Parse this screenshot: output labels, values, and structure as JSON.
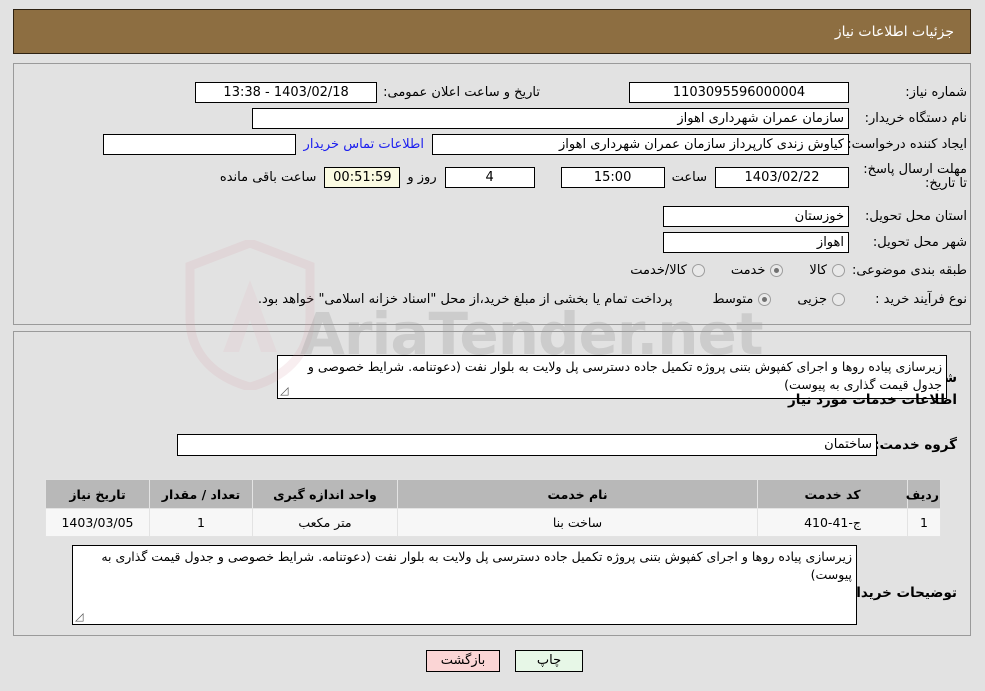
{
  "header": {
    "title": "جزئیات اطلاعات نیاز"
  },
  "top_form": {
    "need_number_label": "شماره نیاز:",
    "need_number_value": "1103095596000004",
    "public_announce_label": "تاریخ و ساعت اعلان عمومی:",
    "public_announce_value": "1403/02/18 - 13:38",
    "buyer_org_label": "نام دستگاه خریدار:",
    "buyer_org_value": "سازمان عمران شهرداری اهواز",
    "creator_label": "ایجاد کننده درخواست:",
    "creator_value": "کیاوش زندی کارپرداز سازمان عمران شهرداری اهواز",
    "contact_link": "اطلاعات تماس خریدار",
    "deadline_label": "مهلت ارسال پاسخ: تا تاریخ:",
    "deadline_date": "1403/02/22",
    "hour_label": "ساعت",
    "deadline_time": "15:00",
    "days_remaining": "4",
    "days_word": "روز و",
    "countdown": "00:51:59",
    "remaining_suffix": "ساعت باقی مانده",
    "province_label": "استان محل تحویل:",
    "province_value": "خوزستان",
    "city_label": "شهر محل تحویل:",
    "city_value": "اهواز",
    "category_label": "طبقه بندی موضوعی:",
    "category_options": [
      {
        "label": "کالا",
        "selected": false
      },
      {
        "label": "خدمت",
        "selected": true
      },
      {
        "label": "کالا/خدمت",
        "selected": false
      }
    ],
    "purchase_type_label": "نوع فرآیند خرید :",
    "purchase_type_options": [
      {
        "label": "جزیی",
        "selected": false
      },
      {
        "label": "متوسط",
        "selected": true
      }
    ],
    "treasury_note": "پرداخت تمام یا بخشی از مبلغ خرید،از محل \"اسناد خزانه اسلامی\" خواهد بود."
  },
  "bottom": {
    "general_desc_label": "شرح کلی نیاز:",
    "general_desc_value": "زیرسازی پیاده روها و اجرای کفپوش بتنی پروژه تکمیل جاده دسترسی پل ولایت به بلوار نفت (دعوتنامه. شرایط خصوصی و جدول قیمت گذاری به پیوست)",
    "services_heading": "اطلاعات خدمات مورد نیاز",
    "service_group_label": "گروه خدمت:",
    "service_group_value": "ساختمان",
    "table": {
      "headers": [
        "ردیف",
        "کد خدمت",
        "نام خدمت",
        "واحد اندازه گیری",
        "تعداد / مقدار",
        "تاریخ نیاز"
      ],
      "rows": [
        [
          "1",
          "ج-41-410",
          "ساخت بنا",
          "متر مکعب",
          "1",
          "1403/03/05"
        ]
      ]
    },
    "buyer_notes_label": "توضیحات خریدار:",
    "buyer_notes_value": "زیرسازی پیاده روها و اجرای کفپوش بتنی پروژه تکمیل جاده دسترسی پل ولایت به بلوار نفت (دعوتنامه. شرایط خصوصی و جدول قیمت گذاری به پیوست)"
  },
  "footer": {
    "back_label": "بازگشت",
    "print_label": "چاپ"
  },
  "watermark": {
    "text": "AriaTender.net"
  },
  "colors": {
    "header_bg": "#8d6e41",
    "link": "#1d20ef",
    "table_header_bg": "#b8b8b8",
    "back_btn_bg": "#fbd5d5",
    "print_btn_bg": "#e7f7e7",
    "countdown_bg": "#fbfbe2"
  }
}
